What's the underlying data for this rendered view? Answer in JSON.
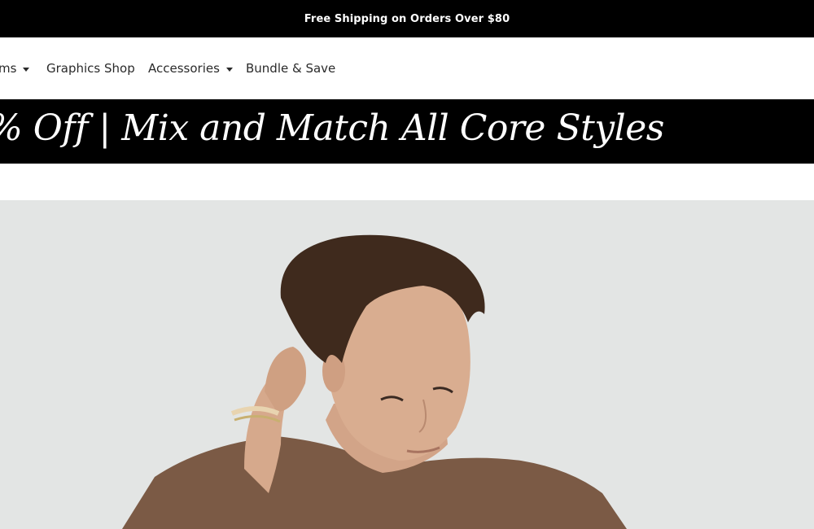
{
  "announcement": {
    "text": "Free Shipping on Orders Over $80"
  },
  "nav": {
    "items": [
      {
        "label": "ms",
        "has_dropdown": true
      },
      {
        "label": "Graphics Shop",
        "has_dropdown": false
      },
      {
        "label": "Accessories",
        "has_dropdown": true
      },
      {
        "label": "Bundle & Save",
        "has_dropdown": false
      }
    ]
  },
  "promo": {
    "text": "% Off  |  Mix and Match All Core Styles"
  },
  "colors": {
    "bar": "#000000",
    "hero_bg": "#e3e5e4",
    "shirt": "#7a5a44",
    "hair": "#3e2a1e",
    "skin": "#d7ab8e"
  }
}
